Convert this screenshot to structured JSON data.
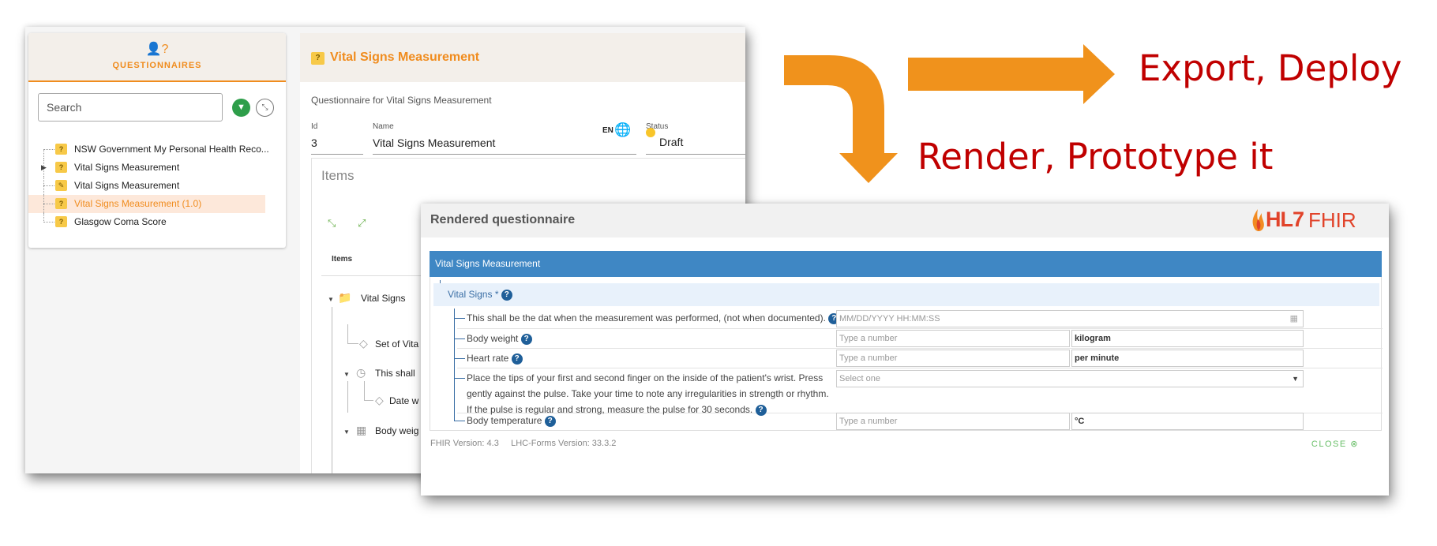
{
  "back_window": {
    "sidebar": {
      "header_title": "QUESTIONNAIRES",
      "search_placeholder": "Search",
      "items": [
        {
          "label": "NSW Government My Personal Health Reco..."
        },
        {
          "label": "Vital Signs Measurement"
        },
        {
          "label": "Vital Signs Measurement"
        },
        {
          "label": "Vital Signs Measurement (1.0)"
        },
        {
          "label": "Glasgow Coma Score"
        }
      ]
    },
    "main": {
      "title": "Vital Signs Measurement",
      "description": "Questionnaire for Vital Signs Measurement",
      "id_label": "Id",
      "id_value": "3",
      "name_label": "Name",
      "name_value": "Vital Signs Measurement",
      "lang": "EN",
      "status_label": "Status",
      "status_value": "Draft",
      "items_title": "Items",
      "items_column": "Items",
      "tree": [
        {
          "label": "Vital Signs"
        },
        {
          "label": "Set of Vita"
        },
        {
          "label": "This shall"
        },
        {
          "label": "Date w"
        },
        {
          "label": "Body weig"
        }
      ]
    }
  },
  "annotations": {
    "export": "Export, Deploy",
    "render": "Render, Prototype it"
  },
  "dialog": {
    "title": "Rendered questionnaire",
    "logo": {
      "hl7": "HL7",
      "fhir": "FHIR"
    },
    "form_title": "Vital Signs Measurement",
    "group_label": "Vital Signs *",
    "questions": [
      {
        "label": "This shall be the dat when the measurement was performed, (not when documented).",
        "placeholder": "MM/DD/YYYY HH:MM:SS"
      },
      {
        "label": "Body weight",
        "placeholder": "Type a number",
        "unit": "kilogram"
      },
      {
        "label": "Heart rate",
        "placeholder": "Type a number",
        "unit": "per minute"
      },
      {
        "label": "Place the tips of your first and second finger on the inside of the patient's wrist. Press gently against the pulse. Take your time to note any irregularities in strength or rhythm. If the pulse is regular and strong, measure the pulse for 30 seconds.",
        "placeholder": "Select one"
      },
      {
        "label": "Body temperature",
        "placeholder": "Type a number",
        "unit": "°C"
      }
    ],
    "fhir_version": "FHIR Version: 4.3",
    "lhc_version": "LHC-Forms Version: 33.3.2",
    "close_label": "CLOSE"
  },
  "colors": {
    "accent": "#f08c1e",
    "arrow": "#f0921c",
    "annotation_text": "#c00000",
    "form_bar": "#3f87c4"
  },
  "icons": [
    "user-question-icon",
    "filter-icon",
    "expand-icon",
    "questionnaire-icon",
    "globe-icon",
    "help-icon",
    "calendar-icon",
    "dropdown-icon",
    "close-circle-icon",
    "folder-icon",
    "tag-icon",
    "clock-icon"
  ]
}
